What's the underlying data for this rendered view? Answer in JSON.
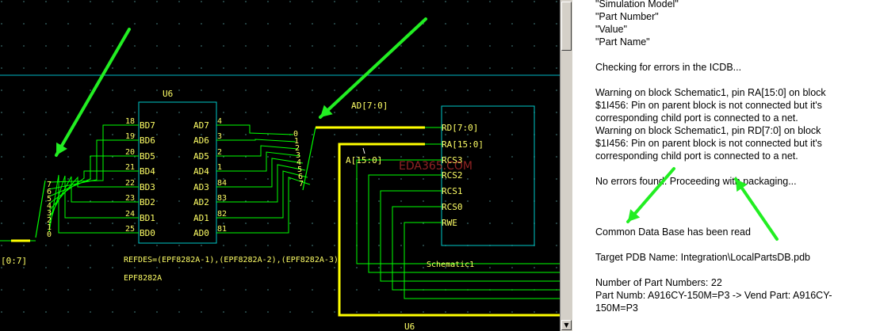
{
  "schematic": {
    "part_u6_top": "U6",
    "part_u6_bottom": "U6",
    "bd_pins": [
      "BD7",
      "BD6",
      "BD5",
      "BD4",
      "BD3",
      "BD2",
      "BD1",
      "BD0"
    ],
    "bd_pin_nums": [
      "18",
      "19",
      "20",
      "21",
      "22",
      "23",
      "24",
      "25"
    ],
    "ad_pins": [
      "AD7",
      "AD6",
      "AD5",
      "AD4",
      "AD3",
      "AD2",
      "AD1",
      "AD0"
    ],
    "ad_pin_nums": [
      "4",
      "3",
      "2",
      "1",
      "84",
      "83",
      "82",
      "81"
    ],
    "right_bus_nums": [
      "0",
      "1",
      "2",
      "3",
      "4",
      "5",
      "6",
      "7"
    ],
    "left_bus_nums": [
      "7",
      "6",
      "5",
      "4",
      "3",
      "2",
      "1",
      "0"
    ],
    "bus_label_ad": "AD[7:0]",
    "bus_label_a": "A[15:0]",
    "left_bus_label": "[0:7]",
    "block_pins": [
      "RD[7:0]",
      "RA[15:0]",
      "RCS3",
      "RCS2",
      "RCS1",
      "RCS0",
      "RWE"
    ],
    "refdes_text": "REFDES=(EPF8282A-1),(EPF8282A-2),(EPF8282A-3)",
    "part_name": "EPF8282A",
    "block_name": "Schematic1",
    "watermark": "EDA365.COM"
  },
  "log": {
    "lines": [
      "\"Simulation Model\"",
      "\"Part Number\"",
      "\"Value\"",
      "\"Part Name\"",
      "",
      "Checking for errors in the ICDB...",
      "",
      "Warning on block Schematic1, pin RA[15:0] on block",
      "$1I456: Pin on parent block is not connected but it's",
      "corresponding child port is connected to a net.",
      "Warning on block Schematic1, pin RD[7:0] on block",
      "$1I456: Pin on parent block is not connected but it's",
      "corresponding child port is connected to a net.",
      "",
      "No errors found. Proceeding with packaging...",
      "",
      "",
      "",
      "Common Data Base has been read",
      "",
      "Target PDB Name: Integration\\LocalPartsDB.pdb",
      "",
      "Number of Part Numbers: 22",
      "Part Numb: A916CY-150M=P3 -> Vend Part: A916CY-",
      "150M=P3"
    ]
  },
  "colors": {
    "background": "#000000",
    "wire": "#00ff00",
    "part_outline": "#00c8c8",
    "text": "#ffff66",
    "highlight_bus": "#ffff00",
    "annotation_arrow": "#22ee22"
  }
}
